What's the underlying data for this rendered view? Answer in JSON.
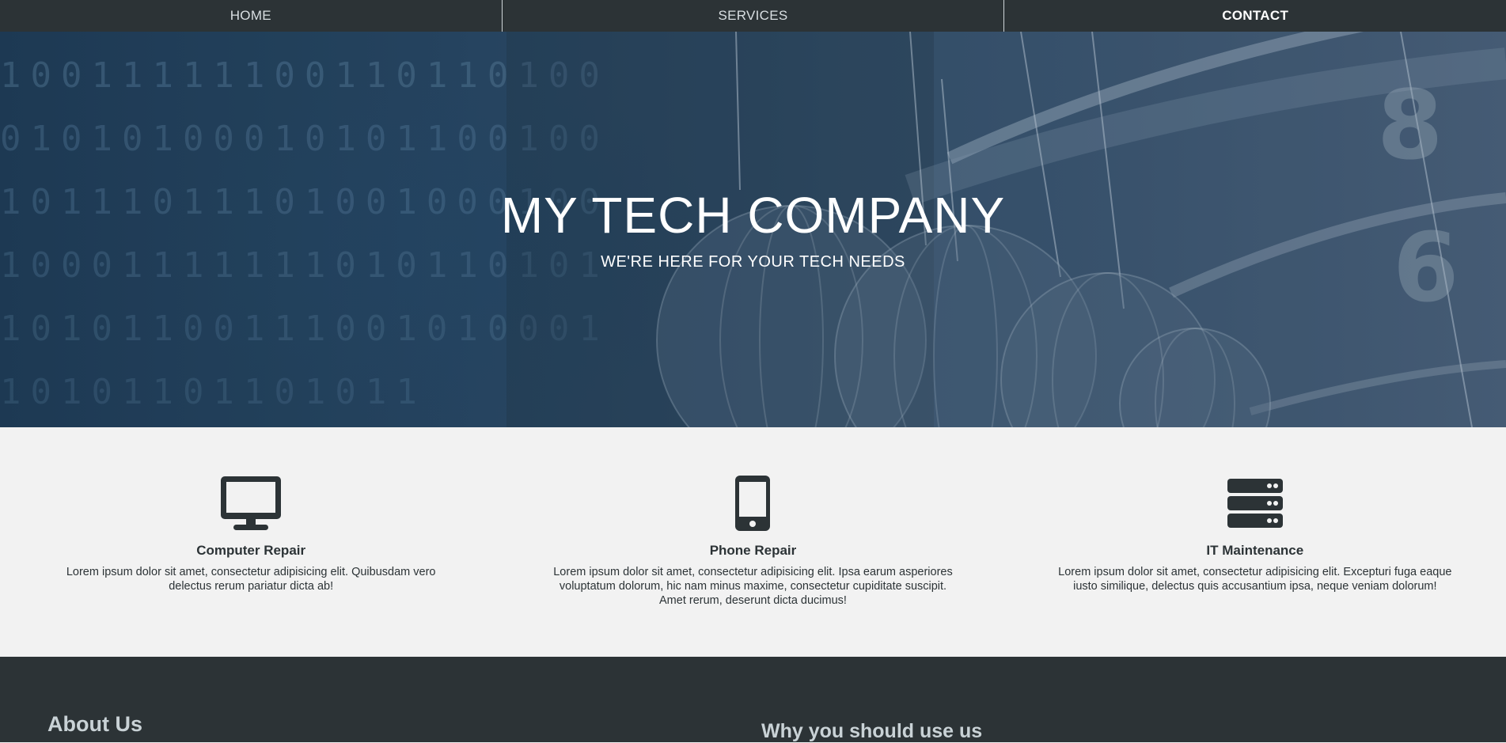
{
  "nav": {
    "items": [
      {
        "label": "HOME"
      },
      {
        "label": "SERVICES"
      },
      {
        "label": "CONTACT"
      }
    ],
    "active": "CONTACT"
  },
  "hero": {
    "title": "MY TECH COMPANY",
    "subtitle": "WE'RE HERE FOR YOUR TECH NEEDS"
  },
  "services": [
    {
      "icon": "desktop-icon",
      "title": "Computer Repair",
      "description": "Lorem ipsum dolor sit amet, consectetur adipisicing elit. Quibusdam vero delectus rerum pariatur dicta ab!"
    },
    {
      "icon": "mobile-phone-icon",
      "title": "Phone Repair",
      "description": "Lorem ipsum dolor sit amet, consectetur adipisicing elit. Ipsa earum asperiores voluptatum dolorum, hic nam minus maxime, consectetur cupiditate suscipit. Amet rerum, deserunt dicta ducimus!"
    },
    {
      "icon": "server-icon",
      "title": "IT Maintenance",
      "description": "Lorem ipsum dolor sit amet, consectetur adipisicing elit. Excepturi fuga eaque iusto similique, delectus quis accusantium ipsa, neque veniam dolorum!"
    }
  ],
  "footer": {
    "about_title": "About Us",
    "why_title": "Why you should use us"
  },
  "colors": {
    "dark": "#2c3336",
    "hero_blue": "#264561",
    "light_bg": "#f2f2f2"
  }
}
